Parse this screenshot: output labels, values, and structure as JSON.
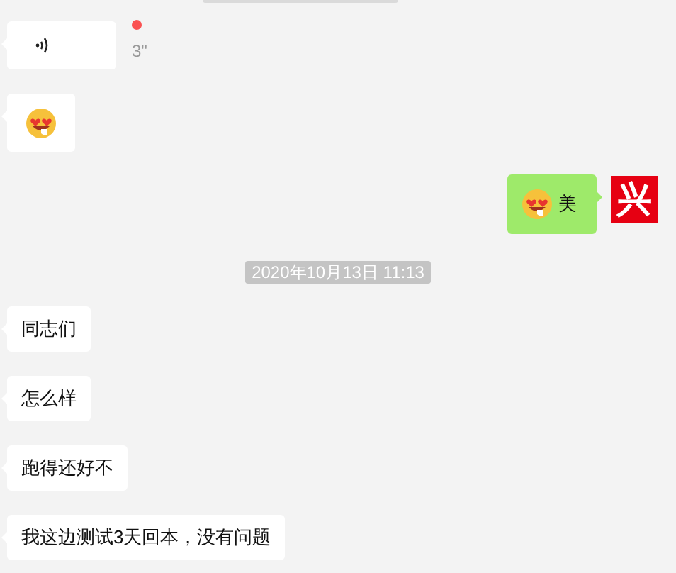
{
  "messages": [
    {
      "kind": "voice",
      "outgoing": false,
      "duration": "3\"",
      "unread": true
    },
    {
      "kind": "emoji",
      "outgoing": false
    },
    {
      "kind": "emoji_text",
      "outgoing": true,
      "text": "美",
      "avatar": "兴"
    },
    {
      "kind": "timestamp",
      "text": "2020年10月13日 11:13"
    },
    {
      "kind": "text",
      "outgoing": false,
      "text": "同志们"
    },
    {
      "kind": "text",
      "outgoing": false,
      "text": "怎么样"
    },
    {
      "kind": "text",
      "outgoing": false,
      "text": "跑得还好不"
    },
    {
      "kind": "text",
      "outgoing": false,
      "text": "我这边测试3天回本，没有问题"
    }
  ]
}
